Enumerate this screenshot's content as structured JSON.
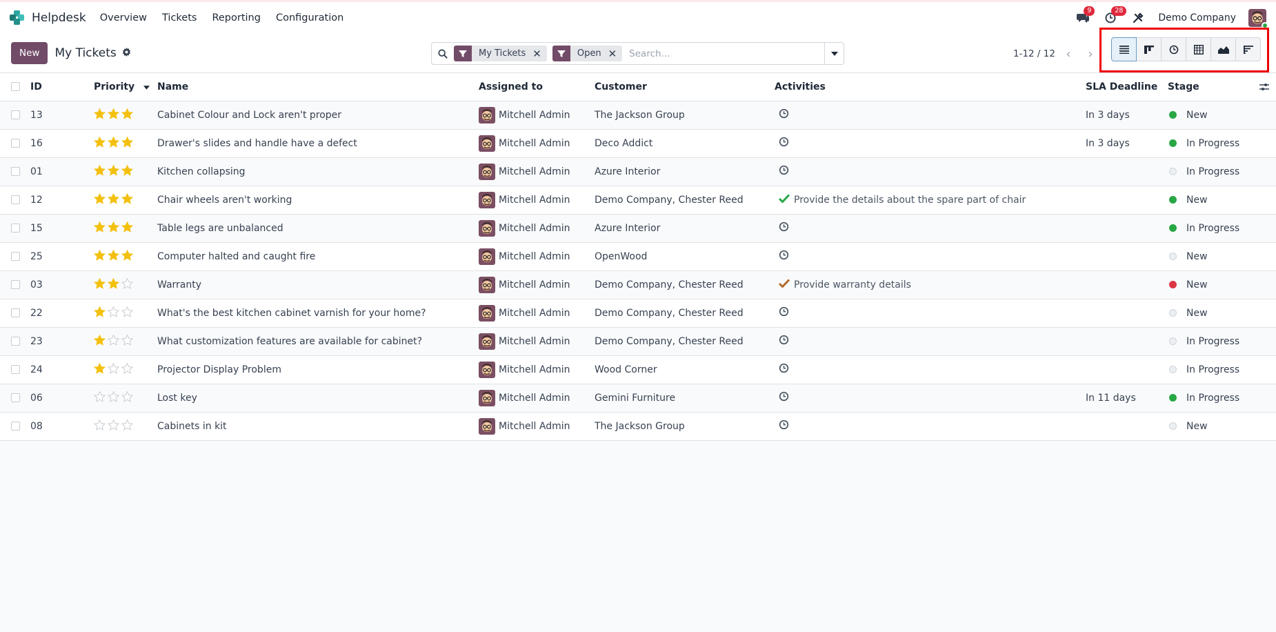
{
  "app": {
    "name": "Helpdesk",
    "menu": [
      "Overview",
      "Tickets",
      "Reporting",
      "Configuration"
    ],
    "messages_count": "9",
    "activities_count": "28",
    "company": "Demo Company"
  },
  "control": {
    "new_label": "New",
    "title": "My Tickets",
    "facets": [
      "My Tickets",
      "Open"
    ],
    "search_placeholder": "Search...",
    "pager": "1-12 / 12",
    "views": [
      "list-icon",
      "kanban-icon",
      "activity-icon",
      "pivot-icon",
      "graph-icon",
      "cohort-icon"
    ]
  },
  "table": {
    "columns": {
      "id": "ID",
      "priority": "Priority",
      "name": "Name",
      "assigned": "Assigned to",
      "customer": "Customer",
      "activities": "Activities",
      "sla": "SLA Deadline",
      "stage": "Stage"
    },
    "rows": [
      {
        "id": "13",
        "priority": 3,
        "name": "Cabinet Colour and Lock aren't proper",
        "assigned": "Mitchell Admin",
        "customer": "The Jackson Group",
        "activity": "",
        "activity_state": "none",
        "sla": "In 3 days",
        "stage_state": "green",
        "stage": "New"
      },
      {
        "id": "16",
        "priority": 3,
        "name": "Drawer's slides and handle have a defect",
        "assigned": "Mitchell Admin",
        "customer": "Deco Addict",
        "activity": "",
        "activity_state": "none",
        "sla": "In 3 days",
        "stage_state": "green",
        "stage": "In Progress"
      },
      {
        "id": "01",
        "priority": 3,
        "name": "Kitchen collapsing",
        "assigned": "Mitchell Admin",
        "customer": "Azure Interior",
        "activity": "",
        "activity_state": "none",
        "sla": "",
        "stage_state": "grey",
        "stage": "In Progress"
      },
      {
        "id": "12",
        "priority": 3,
        "name": "Chair wheels aren't working",
        "assigned": "Mitchell Admin",
        "customer": "Demo Company, Chester Reed",
        "activity": "Provide the details about the spare part of chair",
        "activity_state": "planned",
        "sla": "",
        "stage_state": "green",
        "stage": "New"
      },
      {
        "id": "15",
        "priority": 3,
        "name": "Table legs are unbalanced",
        "assigned": "Mitchell Admin",
        "customer": "Azure Interior",
        "activity": "",
        "activity_state": "none",
        "sla": "",
        "stage_state": "green",
        "stage": "In Progress"
      },
      {
        "id": "25",
        "priority": 3,
        "name": "Computer halted and caught fire",
        "assigned": "Mitchell Admin",
        "customer": "OpenWood",
        "activity": "",
        "activity_state": "none",
        "sla": "",
        "stage_state": "grey",
        "stage": "New"
      },
      {
        "id": "03",
        "priority": 2,
        "name": "Warranty",
        "assigned": "Mitchell Admin",
        "customer": "Demo Company, Chester Reed",
        "activity": "Provide warranty details",
        "activity_state": "overdue",
        "sla": "",
        "stage_state": "red",
        "stage": "New"
      },
      {
        "id": "22",
        "priority": 1,
        "name": "What's the best kitchen cabinet varnish for your home?",
        "assigned": "Mitchell Admin",
        "customer": "Demo Company, Chester Reed",
        "activity": "",
        "activity_state": "none",
        "sla": "",
        "stage_state": "grey",
        "stage": "New"
      },
      {
        "id": "23",
        "priority": 1,
        "name": "What customization features are available for cabinet?",
        "assigned": "Mitchell Admin",
        "customer": "Demo Company, Chester Reed",
        "activity": "",
        "activity_state": "none",
        "sla": "",
        "stage_state": "grey",
        "stage": "In Progress"
      },
      {
        "id": "24",
        "priority": 1,
        "name": "Projector Display Problem",
        "assigned": "Mitchell Admin",
        "customer": "Wood Corner",
        "activity": "",
        "activity_state": "none",
        "sla": "",
        "stage_state": "grey",
        "stage": "In Progress"
      },
      {
        "id": "06",
        "priority": 0,
        "name": "Lost key",
        "assigned": "Mitchell Admin",
        "customer": "Gemini Furniture",
        "activity": "",
        "activity_state": "none",
        "sla": "In 11 days",
        "stage_state": "green",
        "stage": "In Progress"
      },
      {
        "id": "08",
        "priority": 0,
        "name": "Cabinets in kit",
        "assigned": "Mitchell Admin",
        "customer": "The Jackson Group",
        "activity": "",
        "activity_state": "none",
        "sla": "",
        "stage_state": "grey",
        "stage": "New"
      }
    ]
  },
  "colors": {
    "brand": "#714b67",
    "star_on": "#f3c00e",
    "star_off": "#c4c9cf",
    "planned": "#28a745",
    "overdue": "#b06a2c",
    "highlight": "#ee0000"
  }
}
